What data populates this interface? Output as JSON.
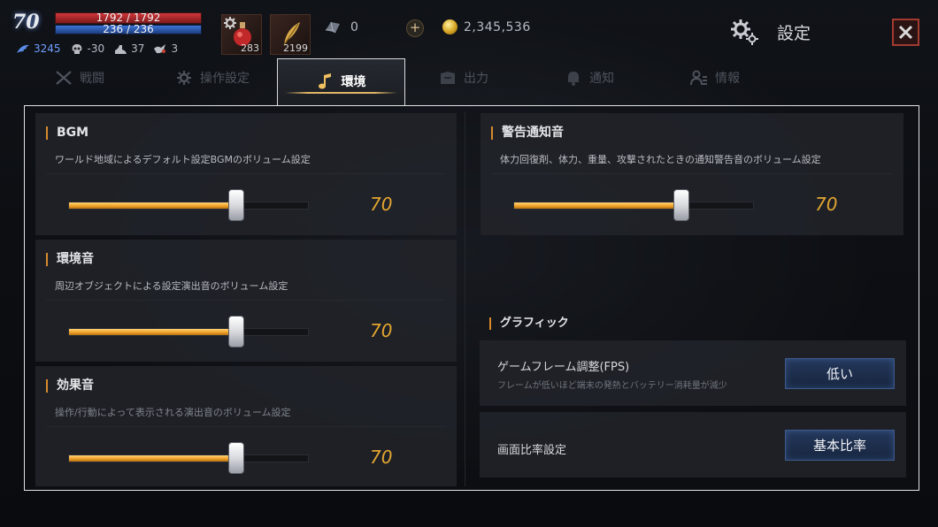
{
  "player": {
    "level": "70",
    "hp": "1792 / 1792",
    "mp": "236 / 236",
    "stats": [
      {
        "icon": "wing-icon",
        "value": "3245"
      },
      {
        "icon": "skull-icon",
        "value": "-30"
      },
      {
        "icon": "boot-icon",
        "value": "37"
      },
      {
        "icon": "bird-icon",
        "value": "3"
      }
    ]
  },
  "items": [
    {
      "icon": "potion-icon",
      "count": "283"
    },
    {
      "icon": "feather-icon",
      "count": "2199"
    }
  ],
  "currency": {
    "crystal": "0",
    "add_label": "+",
    "gold": "2,345,536"
  },
  "header": {
    "title": "設定",
    "close_label": "✕"
  },
  "tabs": [
    {
      "label": "戦闘",
      "icon": "swords-icon"
    },
    {
      "label": "操作設定",
      "icon": "gear-icon"
    },
    {
      "label": "環境",
      "icon": "music-note-icon",
      "active": true
    },
    {
      "label": "出力",
      "icon": "output-icon"
    },
    {
      "label": "通知",
      "icon": "bell-icon"
    },
    {
      "label": "情報",
      "icon": "user-info-icon"
    }
  ],
  "sound": {
    "bgm": {
      "title": "BGM",
      "desc": "ワールド地域によるデフォルト設定BGMのボリューム設定",
      "value": 70
    },
    "ambient": {
      "title": "環境音",
      "desc": "周辺オブジェクトによる設定演出音のボリューム設定",
      "value": 70
    },
    "effects": {
      "title": "効果音",
      "desc": "操作/行動によって表示される演出音のボリューム設定",
      "value": 70
    },
    "warning": {
      "title": "警告通知音",
      "desc": "体力回復剤、体力、重量、攻撃されたときの通知警告音のボリューム設定",
      "value": 70
    }
  },
  "graphics": {
    "header": "グラフィック",
    "fps": {
      "label": "ゲームフレーム調整(FPS)",
      "sub": "フレームが低いほど端末の発熱とバッテリー消耗量が減少",
      "value": "低い"
    },
    "aspect": {
      "label": "画面比率設定",
      "value": "基本比率"
    }
  },
  "colors": {
    "accent": "#e3a630",
    "slider_fill": "#f0a328",
    "panel_border": "#e1e3e7",
    "close_red": "#a23a30"
  }
}
